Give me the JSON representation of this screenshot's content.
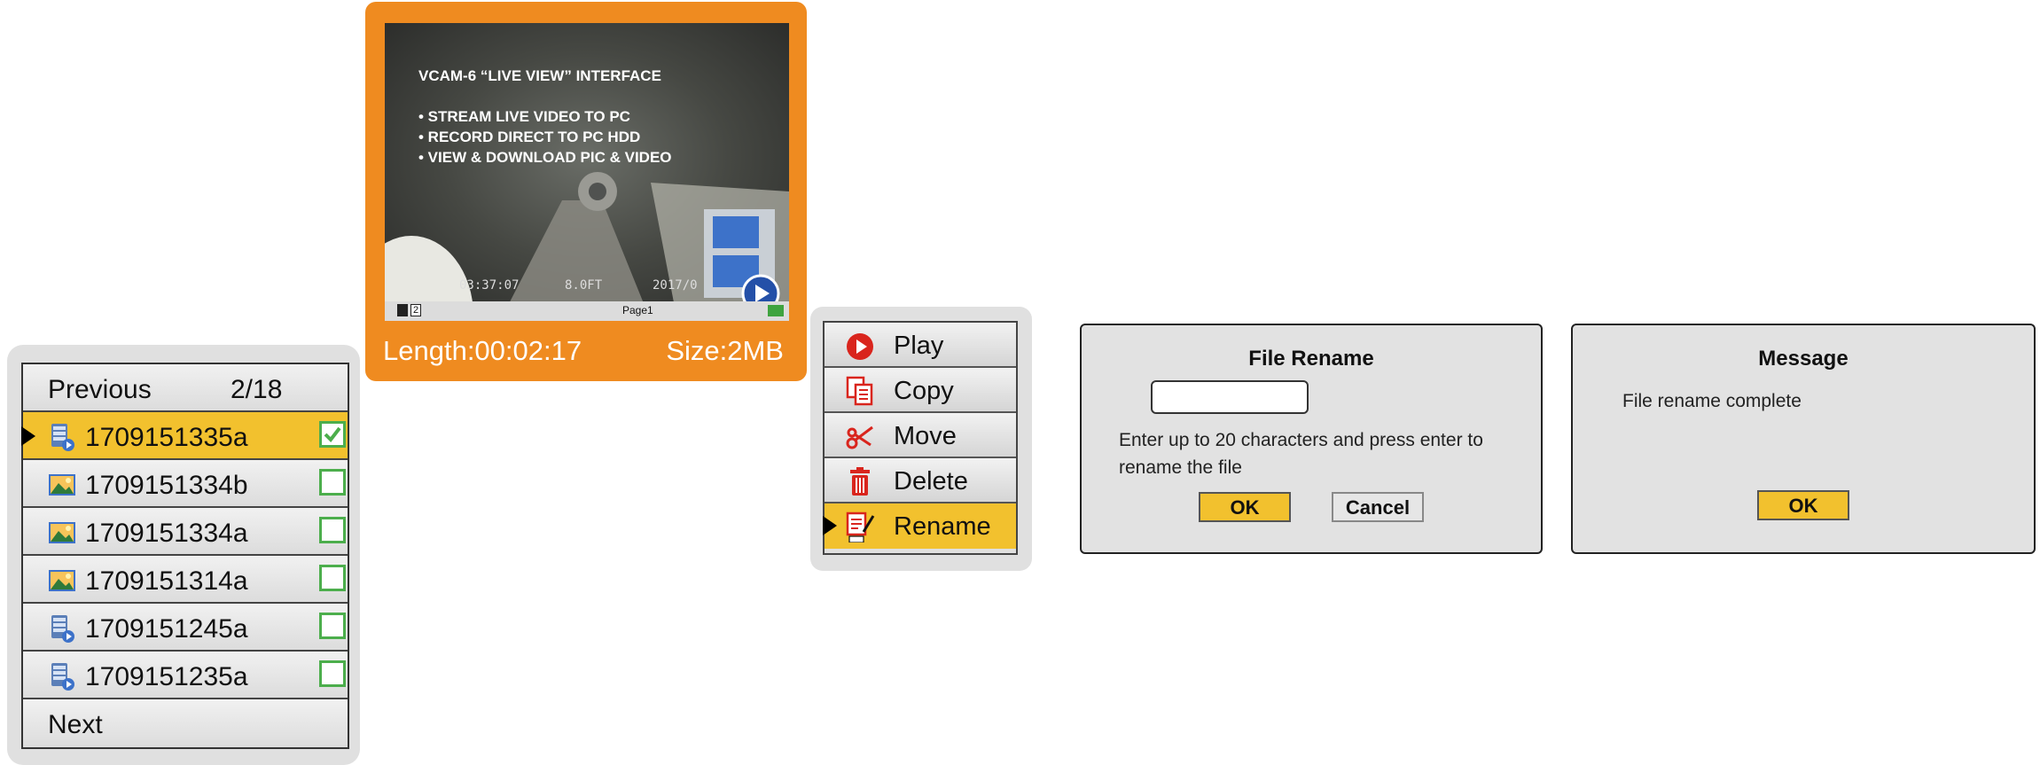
{
  "file_list": {
    "prev_label": "Previous",
    "page_count": "2/18",
    "next_label": "Next",
    "items": [
      {
        "name": "1709151335a",
        "type": "video",
        "checked": true,
        "selected": true
      },
      {
        "name": "1709151334b",
        "type": "photo",
        "checked": false,
        "selected": false
      },
      {
        "name": "1709151334a",
        "type": "photo",
        "checked": false,
        "selected": false
      },
      {
        "name": "1709151314a",
        "type": "photo",
        "checked": false,
        "selected": false
      },
      {
        "name": "1709151245a",
        "type": "video",
        "checked": false,
        "selected": false
      },
      {
        "name": "1709151235a",
        "type": "video",
        "checked": false,
        "selected": false
      }
    ]
  },
  "preview": {
    "overlay_title": "VCAM-6 “LIVE VIEW” INTERFACE",
    "bullets": [
      "• STREAM LIVE VIDEO TO PC",
      "• RECORD DIRECT TO PC HDD",
      "• VIEW & DOWNLOAD PIC & VIDEO"
    ],
    "osd_time": "03:37:07",
    "osd_distance": "8.0FT",
    "osd_date": "2017/0",
    "status_page": "Page1",
    "status_badge": "2",
    "length_text": "Length:00:02:17",
    "size_text": "Size:2MB",
    "video_badge_icon": "film-play-icon"
  },
  "menu": {
    "items": [
      {
        "label": "Play",
        "icon": "play-icon"
      },
      {
        "label": "Copy",
        "icon": "copy-icon"
      },
      {
        "label": "Move",
        "icon": "scissors-icon"
      },
      {
        "label": "Delete",
        "icon": "trash-icon"
      },
      {
        "label": "Rename",
        "icon": "rename-icon",
        "selected": true
      }
    ]
  },
  "rename_dialog": {
    "title": "File Rename",
    "input_value": "",
    "hint_line1": "Enter up to 20 characters and press enter to",
    "hint_line2": "rename the file",
    "ok_label": "OK",
    "cancel_label": "Cancel"
  },
  "message_dialog": {
    "title": "Message",
    "text": "File rename complete",
    "ok_label": "OK"
  },
  "colors": {
    "accent_yellow": "#f2c12e",
    "preview_orange": "#ef8b20",
    "check_green": "#4cae4c",
    "icon_red": "#d9251d",
    "file_icon_blue": "#3d72c9"
  }
}
